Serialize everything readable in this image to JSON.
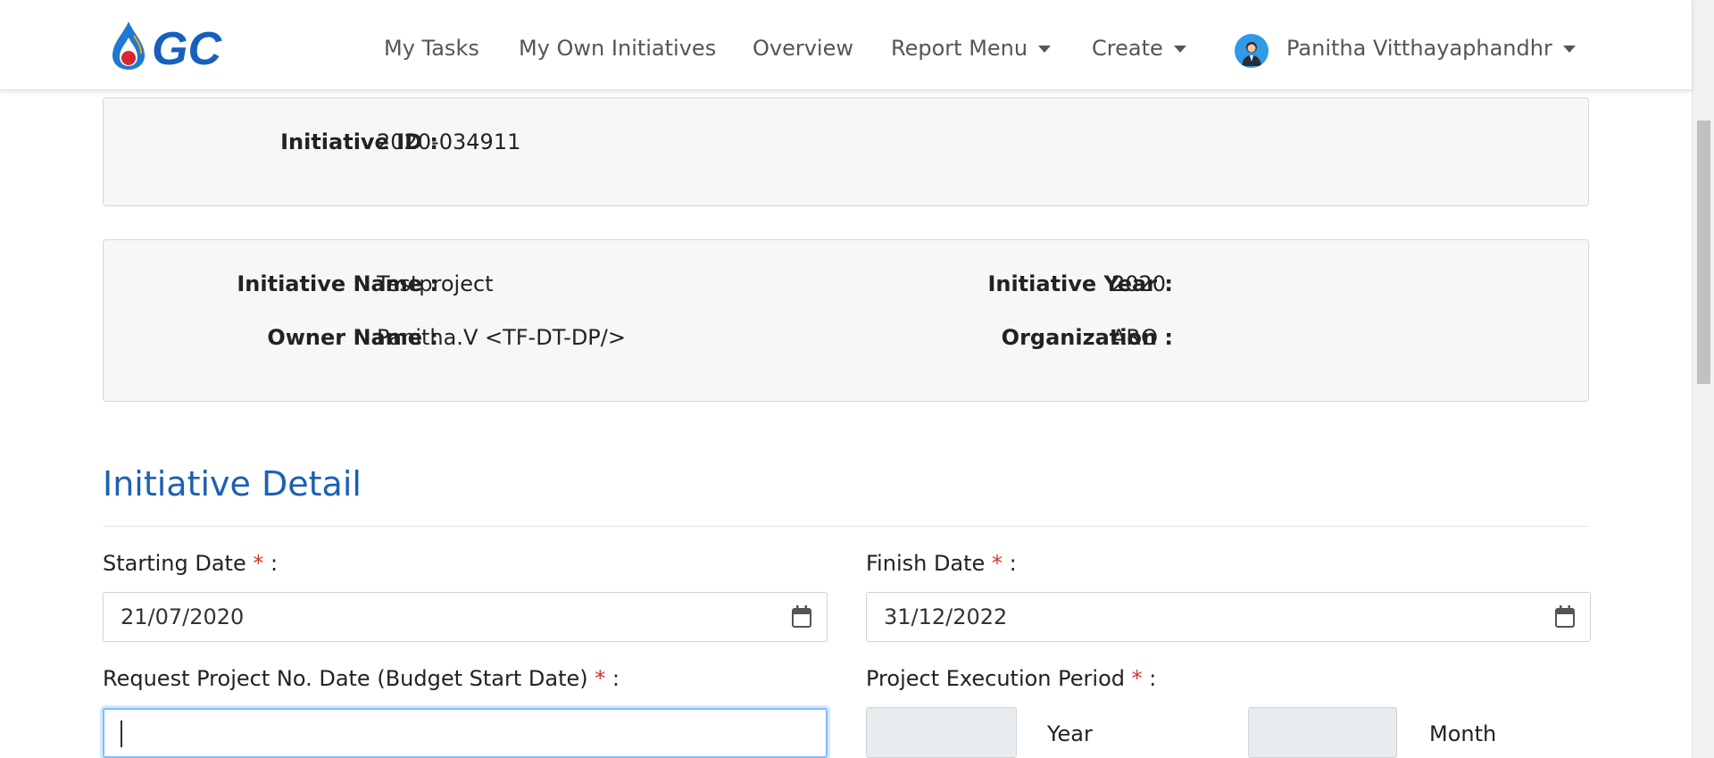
{
  "nav": {
    "logo_text": "GC",
    "items": [
      "My Tasks",
      "My Own Initiatives",
      "Overview",
      "Report Menu",
      "Create"
    ],
    "user_name": "Panitha Vitthayaphandhr"
  },
  "panel1": {
    "id_label": "Initiative ID :",
    "id_value": "2020-034911"
  },
  "panel2": {
    "name_label": "Initiative Name :",
    "name_value": "Testproject",
    "owner_label": "Owner Name :",
    "owner_value": "Panitha.V <TF-DT-DP/>",
    "year_label": "Initiative Year :",
    "year_value": "2020",
    "org_label": "Organization :",
    "org_value": "ARO"
  },
  "detail": {
    "title": "Initiative Detail",
    "starting_label": "Starting Date",
    "starting_value": "21/07/2020",
    "finish_label": "Finish Date",
    "finish_value": "31/12/2022",
    "request_label": "Request Project No. Date (Budget Start Date)",
    "execution_label": "Project Execution Period",
    "year_unit": "Year",
    "month_unit": "Month",
    "required_mark": "*",
    "colon": ":"
  },
  "colors": {
    "brand_blue": "#1a61b2",
    "required_red": "#d9312b",
    "focus_blue": "#80bdff"
  }
}
